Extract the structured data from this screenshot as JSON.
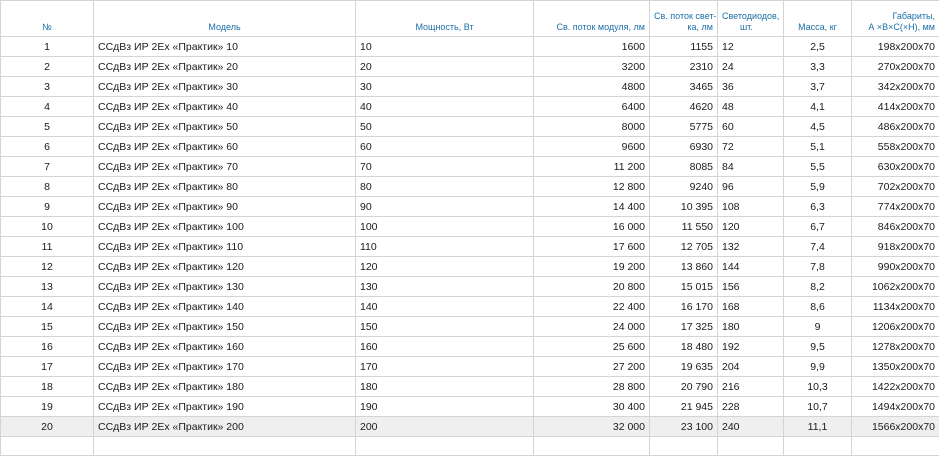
{
  "table": {
    "headers": {
      "num": "№",
      "model": "Модель",
      "power": "Мощность, Вт",
      "module_flux": "Св. поток модуля, лм",
      "lamp_flux_1": "Св. поток свет-",
      "lamp_flux_2": "ка, лм",
      "leds_1": "Светодиодов,",
      "leds_2": "шт.",
      "mass": "Масса, кг",
      "dims_1": "Габариты,",
      "dims_2": "А ×В×С(×Н), мм"
    },
    "rows": [
      {
        "num": "1",
        "model": "ССдВз ИР 2Ех «Практик» 10",
        "power": "10",
        "module_flux": "1600",
        "lamp_flux": "1155",
        "leds": "12",
        "mass": "2,5",
        "dims": "198x200x70"
      },
      {
        "num": "2",
        "model": "ССдВз ИР 2Ех «Практик» 20",
        "power": "20",
        "module_flux": "3200",
        "lamp_flux": "2310",
        "leds": "24",
        "mass": "3,3",
        "dims": "270x200x70"
      },
      {
        "num": "3",
        "model": "ССдВз ИР 2Ех «Практик» 30",
        "power": "30",
        "module_flux": "4800",
        "lamp_flux": "3465",
        "leds": "36",
        "mass": "3,7",
        "dims": "342x200x70"
      },
      {
        "num": "4",
        "model": "ССдВз ИР 2Ех «Практик» 40",
        "power": "40",
        "module_flux": "6400",
        "lamp_flux": "4620",
        "leds": "48",
        "mass": "4,1",
        "dims": "414x200x70"
      },
      {
        "num": "5",
        "model": "ССдВз ИР  2Ех «Практик» 50",
        "power": "50",
        "module_flux": "8000",
        "lamp_flux": "5775",
        "leds": "60",
        "mass": "4,5",
        "dims": "486x200x70"
      },
      {
        "num": "6",
        "model": "ССдВз ИР 2Ех «Практик» 60",
        "power": "60",
        "module_flux": "9600",
        "lamp_flux": "6930",
        "leds": "72",
        "mass": "5,1",
        "dims": "558x200x70"
      },
      {
        "num": "7",
        "model": "ССдВз ИР 2Ех «Практик» 70",
        "power": "70",
        "module_flux": "11 200",
        "lamp_flux": "8085",
        "leds": "84",
        "mass": "5,5",
        "dims": "630x200x70"
      },
      {
        "num": "8",
        "model": "ССдВз ИР 2Ех «Практик» 80",
        "power": "80",
        "module_flux": "12 800",
        "lamp_flux": "9240",
        "leds": "96",
        "mass": "5,9",
        "dims": "702x200x70"
      },
      {
        "num": "9",
        "model": "ССдВз ИР 2Ех «Практик» 90",
        "power": "90",
        "module_flux": "14 400",
        "lamp_flux": "10 395",
        "leds": "108",
        "mass": "6,3",
        "dims": "774x200x70"
      },
      {
        "num": "10",
        "model": "ССдВз ИР 2Ех «Практик» 100",
        "power": "100",
        "module_flux": "16 000",
        "lamp_flux": "11 550",
        "leds": "120",
        "mass": "6,7",
        "dims": "846x200x70"
      },
      {
        "num": "11",
        "model": "ССдВз ИР 2Ех «Практик» 110",
        "power": "110",
        "module_flux": "17 600",
        "lamp_flux": "12 705",
        "leds": "132",
        "mass": "7,4",
        "dims": "918x200x70"
      },
      {
        "num": "12",
        "model": "ССдВз ИР 2Ех «Практик» 120",
        "power": "120",
        "module_flux": "19 200",
        "lamp_flux": "13 860",
        "leds": "144",
        "mass": "7,8",
        "dims": "990x200x70"
      },
      {
        "num": "13",
        "model": "ССдВз ИР 2Ех «Практик» 130",
        "power": "130",
        "module_flux": "20 800",
        "lamp_flux": "15 015",
        "leds": "156",
        "mass": "8,2",
        "dims": "1062x200x70"
      },
      {
        "num": "14",
        "model": "ССдВз ИР 2Ех «Практик» 140",
        "power": "140",
        "module_flux": "22 400",
        "lamp_flux": "16 170",
        "leds": "168",
        "mass": "8,6",
        "dims": "1134x200x70"
      },
      {
        "num": "15",
        "model": "ССдВз ИР 2Ех «Практик» 150",
        "power": "150",
        "module_flux": "24 000",
        "lamp_flux": "17 325",
        "leds": "180",
        "mass": "9",
        "dims": "1206x200x70"
      },
      {
        "num": "16",
        "model": "ССдВз ИР 2Ех «Практик» 160",
        "power": "160",
        "module_flux": "25 600",
        "lamp_flux": "18 480",
        "leds": "192",
        "mass": "9,5",
        "dims": "1278x200x70"
      },
      {
        "num": "17",
        "model": "ССдВз ИР 2Ех «Практик» 170",
        "power": "170",
        "module_flux": "27 200",
        "lamp_flux": "19 635",
        "leds": "204",
        "mass": "9,9",
        "dims": "1350x200x70"
      },
      {
        "num": "18",
        "model": "ССдВз ИР 2Ех «Практик» 180",
        "power": "180",
        "module_flux": "28 800",
        "lamp_flux": "20 790",
        "leds": "216",
        "mass": "10,3",
        "dims": "1422x200x70"
      },
      {
        "num": "19",
        "model": "ССдВз ИР 2Ех «Практик» 190",
        "power": "190",
        "module_flux": "30 400",
        "lamp_flux": "21 945",
        "leds": "228",
        "mass": "10,7",
        "dims": "1494x200x70"
      },
      {
        "num": "20",
        "model": "ССдВз ИР 2Ех «Практик» 200",
        "power": "200",
        "module_flux": "32 000",
        "lamp_flux": "23 100",
        "leds": "240",
        "mass": "11,1",
        "dims": "1566x200x70"
      }
    ]
  },
  "colors": {
    "header_text": "#1b6fa8",
    "grid": "#d4d4d4",
    "highlight_row": "#efefef"
  }
}
